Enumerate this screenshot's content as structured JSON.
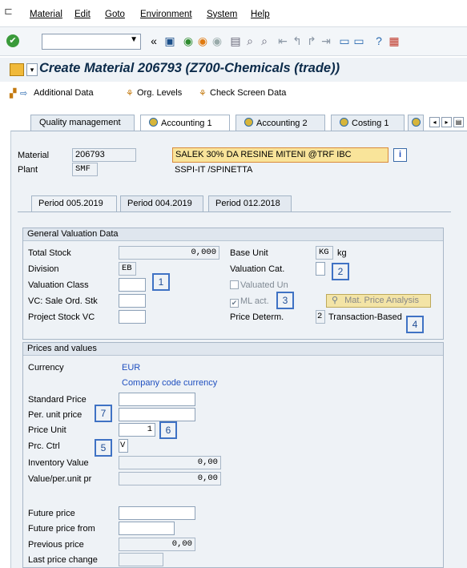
{
  "menu": {
    "items": [
      "Material",
      "Edit",
      "Goto",
      "Environment",
      "System",
      "Help"
    ]
  },
  "toolbar": {
    "command_field": ""
  },
  "title": {
    "text": "Create Material 206793 (Z700-Chemicals (trade))"
  },
  "app_toolbar": {
    "additional_data": "Additional Data",
    "org_levels": "Org. Levels",
    "check_screen": "Check Screen Data"
  },
  "tabs": [
    "Quality management",
    "Accounting 1",
    "Accounting 2",
    "Costing 1"
  ],
  "header": {
    "material_label": "Material",
    "material_value": "206793",
    "material_desc": "SALEK 30% DA RESINE MITENI @TRF IBC",
    "plant_label": "Plant",
    "plant_value": "SMF",
    "plant_desc": "SSPI-IT /SPINETTA"
  },
  "period_tabs": [
    "Period 005.2019",
    "Period 004.2019",
    "Period 012.2018"
  ],
  "general_valuation": {
    "title": "General Valuation Data",
    "total_stock_label": "Total Stock",
    "total_stock_value": "0,000",
    "base_unit_label": "Base Unit",
    "base_unit_value": "KG",
    "base_unit_text": "kg",
    "division_label": "Division",
    "division_value": "EB",
    "valuation_cat_label": "Valuation Cat.",
    "valuation_class_label": "Valuation Class",
    "valuated_un_label": "Valuated Un",
    "vc_sale_label": "VC: Sale Ord. Stk",
    "ml_act_label": "ML act.",
    "mat_price_button": "Mat. Price Analysis",
    "project_stock_label": "Project Stock VC",
    "price_determ_label": "Price Determ.",
    "price_determ_value": "2",
    "price_determ_text": "Transaction-Based"
  },
  "prices": {
    "title": "Prices and values",
    "currency_label": "Currency",
    "currency_value": "EUR",
    "company_code_currency": "Company code currency",
    "standard_price_label": "Standard Price",
    "per_unit_price_label": "Per. unit price",
    "price_unit_label": "Price Unit",
    "price_unit_value": "1",
    "prc_ctrl_label": "Prc. Ctrl",
    "prc_ctrl_value": "V",
    "inventory_value_label": "Inventory Value",
    "inventory_value_value": "0,00",
    "value_per_unit_label": "Value/per.unit pr",
    "value_per_unit_value": "0,00",
    "future_price_label": "Future price",
    "future_price_from_label": "Future price from",
    "previous_price_label": "Previous price",
    "previous_price_value": "0,00",
    "last_price_change_label": "Last price change"
  },
  "annotations": [
    "1",
    "2",
    "3",
    "4",
    "5",
    "6",
    "7"
  ],
  "colors": {
    "accent": "#3f72c4",
    "title": "#0c2b4a",
    "highlight": "#f9e49a"
  }
}
